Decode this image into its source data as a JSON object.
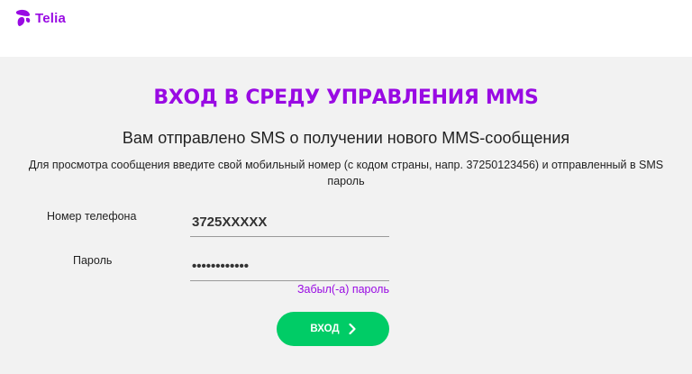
{
  "header": {
    "logo_text": "Telia",
    "logo_icon": "telia-pebble-icon",
    "brand_color": "#990ae3"
  },
  "main": {
    "title": "ВХОД В СРЕДУ УПРАВЛЕНИЯ MMS",
    "subtitle": "Вам отправлено SMS о получении нового MMS-сообщения",
    "instructions": "Для просмотра сообщения введите свой мобильный номер (с кодом страны, напр. 37250123456) и отправленный в SMS пароль"
  },
  "form": {
    "phone_label": "Номер телефона",
    "phone_value": "3725XXXXX",
    "password_label": "Пароль",
    "password_value": "••••••••••••",
    "forgot_link": "Забыл(-а) пароль",
    "submit_label": "ВХОД",
    "submit_icon": "chevron-right-icon",
    "submit_color": "#00cc66"
  }
}
